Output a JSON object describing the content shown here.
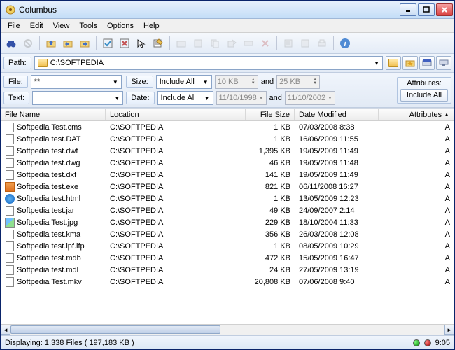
{
  "window": {
    "title": "Columbus"
  },
  "menu": {
    "file": "File",
    "edit": "Edit",
    "view": "View",
    "tools": "Tools",
    "options": "Options",
    "help": "Help"
  },
  "path": {
    "label": "Path:",
    "value": "C:\\SOFTPEDIA"
  },
  "filters": {
    "file_label": "File:",
    "file_value": "**",
    "text_label": "Text:",
    "text_value": "",
    "size_label": "Size:",
    "size_mode": "Include All",
    "size_from": "10 KB",
    "size_to": "25 KB",
    "date_label": "Date:",
    "date_mode": "Include All",
    "date_from": "11/10/1998",
    "date_to": "11/10/2002",
    "and": "and",
    "attr_label": "Attributes:",
    "attr_value": "Include All"
  },
  "columns": {
    "name": "File Name",
    "location": "Location",
    "size": "File Size",
    "date": "Date Modified",
    "attr": "Attributes"
  },
  "files": [
    {
      "icon": "generic",
      "name": "Softpedia Test.cms",
      "location": "C:\\SOFTPEDIA",
      "size": "1 KB",
      "date": "07/03/2008 8:38",
      "attr": "A"
    },
    {
      "icon": "generic",
      "name": "Softpedia test.DAT",
      "location": "C:\\SOFTPEDIA",
      "size": "1 KB",
      "date": "16/06/2009 11:55",
      "attr": "A"
    },
    {
      "icon": "generic",
      "name": "Softpedia test.dwf",
      "location": "C:\\SOFTPEDIA",
      "size": "1,395 KB",
      "date": "19/05/2009 11:49",
      "attr": "A"
    },
    {
      "icon": "generic",
      "name": "Softpedia test.dwg",
      "location": "C:\\SOFTPEDIA",
      "size": "46 KB",
      "date": "19/05/2009 11:48",
      "attr": "A"
    },
    {
      "icon": "generic",
      "name": "Softpedia test.dxf",
      "location": "C:\\SOFTPEDIA",
      "size": "141 KB",
      "date": "19/05/2009 11:49",
      "attr": "A"
    },
    {
      "icon": "exe",
      "name": "Softpedia test.exe",
      "location": "C:\\SOFTPEDIA",
      "size": "821 KB",
      "date": "06/11/2008 16:27",
      "attr": "A"
    },
    {
      "icon": "html",
      "name": "Softpedia test.html",
      "location": "C:\\SOFTPEDIA",
      "size": "1 KB",
      "date": "13/05/2009 12:23",
      "attr": "A"
    },
    {
      "icon": "generic",
      "name": "Softpedia test.jar",
      "location": "C:\\SOFTPEDIA",
      "size": "49 KB",
      "date": "24/09/2007 2:14",
      "attr": "A"
    },
    {
      "icon": "img",
      "name": "Softpedia Test.jpg",
      "location": "C:\\SOFTPEDIA",
      "size": "229 KB",
      "date": "18/10/2004 11:33",
      "attr": "A"
    },
    {
      "icon": "generic",
      "name": "Softpedia test.kma",
      "location": "C:\\SOFTPEDIA",
      "size": "356 KB",
      "date": "26/03/2008 12:08",
      "attr": "A"
    },
    {
      "icon": "generic",
      "name": "Softpedia test.lpf.lfp",
      "location": "C:\\SOFTPEDIA",
      "size": "1 KB",
      "date": "08/05/2009 10:29",
      "attr": "A"
    },
    {
      "icon": "generic",
      "name": "Softpedia test.mdb",
      "location": "C:\\SOFTPEDIA",
      "size": "472 KB",
      "date": "15/05/2009 16:47",
      "attr": "A"
    },
    {
      "icon": "generic",
      "name": "Softpedia test.mdl",
      "location": "C:\\SOFTPEDIA",
      "size": "24 KB",
      "date": "27/05/2009 13:19",
      "attr": "A"
    },
    {
      "icon": "generic",
      "name": "Softpedia Test.mkv",
      "location": "C:\\SOFTPEDIA",
      "size": "20,808 KB",
      "date": "07/06/2008 9:40",
      "attr": "A"
    }
  ],
  "status": {
    "text": "Displaying: 1,338 Files ( 197,183 KB )",
    "time": "9:05"
  }
}
